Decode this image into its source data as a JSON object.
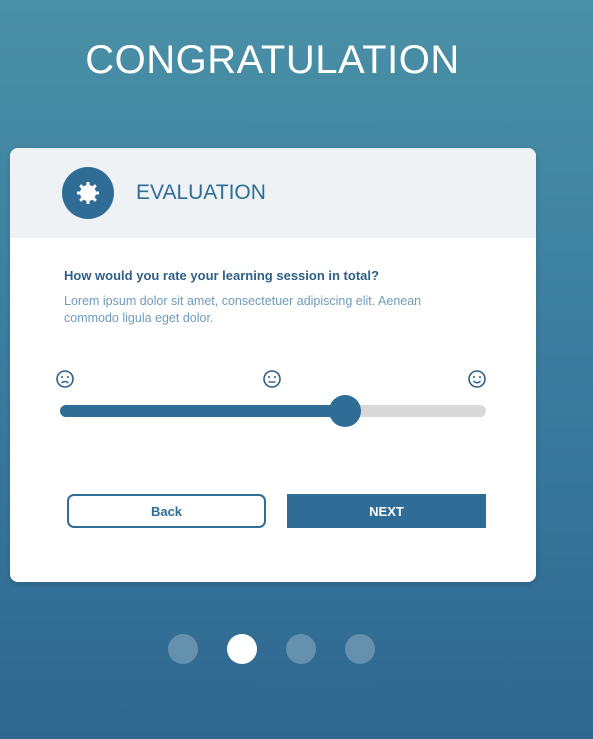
{
  "header": {
    "title": "CONGRATULATION"
  },
  "card": {
    "title": "EVALUATION",
    "badge_icon": "gear-icon",
    "question": "How would you rate your learning session in total?",
    "description": "Lorem ipsum dolor sit amet, consectetuer adipiscing elit. Aenean commodo ligula eget dolor.",
    "rating_icons": [
      "sad-face-icon",
      "neutral-face-icon",
      "happy-face-icon"
    ],
    "slider_value": 0.67
  },
  "buttons": {
    "back_label": "Back",
    "next_label": "NEXT"
  },
  "pagination": {
    "total": 4,
    "active_index": 1
  },
  "colors": {
    "primary": "#2f6c96",
    "header_bg": "#eef2f5",
    "question_text": "#2f5f86",
    "description_text": "#6f9bbb",
    "track": "#d9d9d9"
  }
}
